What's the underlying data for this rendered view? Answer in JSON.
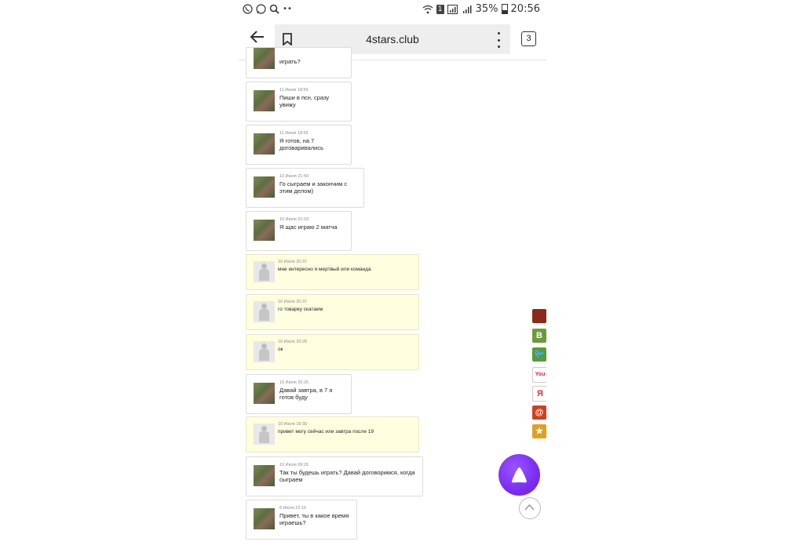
{
  "status_bar": {
    "battery": "35%",
    "time": "20:56",
    "sim": "1",
    "left_icons": [
      "viber-icon",
      "whatsapp-icon",
      "search-icon",
      "more-dots-icon"
    ]
  },
  "browser": {
    "url": "4stars.club",
    "tabs_count": "3"
  },
  "messages": [
    {
      "date": "",
      "text": "играть?",
      "style": "white",
      "avatar": "photo"
    },
    {
      "date": "11 Июля 18:56",
      "text": "Пиши в псн, сразу увижу",
      "style": "white",
      "avatar": "photo"
    },
    {
      "date": "11 Июля 18:55",
      "text": "Я готов, на 7 договаривались",
      "style": "white",
      "avatar": "photo"
    },
    {
      "date": "10 Июля 21:50",
      "text": "Го сыграем и закончим с этим делом)",
      "style": "white",
      "avatar": "photo"
    },
    {
      "date": "10 Июля 21:03",
      "text": "Я щас играю 2 матча",
      "style": "white",
      "avatar": "photo"
    },
    {
      "date": "10 Июля 20:37",
      "text": "мне интересно я мертвый или команда",
      "style": "yellow",
      "avatar": "gray"
    },
    {
      "date": "10 Июля 20:37",
      "text": "го товарку скатаем",
      "style": "yellow",
      "avatar": "gray"
    },
    {
      "date": "10 Июля 20:26",
      "text": "ок",
      "style": "yellow",
      "avatar": "gray"
    },
    {
      "date": "10 Июля 20:26",
      "text": "Давай завтра, в 7 я готов буду",
      "style": "white",
      "avatar": "photo"
    },
    {
      "date": "10 Июля 19:39",
      "text": "привет могу сейчас или завтра после 19",
      "style": "yellow",
      "avatar": "gray"
    },
    {
      "date": "10 Июля 09:26",
      "text": "Так ты будешь играть? Давай договоримся, когда сыграем",
      "style": "white",
      "avatar": "photo"
    },
    {
      "date": "8 Июля 22:15",
      "text": "Привет, ты в какое время играешь?",
      "style": "white",
      "avatar": "photo"
    }
  ],
  "share_icons": [
    {
      "name": "cap-icon",
      "label": "",
      "color": "#8b2a1a"
    },
    {
      "name": "vk-icon",
      "label": "B",
      "color": "#6a9a3a"
    },
    {
      "name": "twitter-icon",
      "label": "🐦",
      "color": "#5a9a3a"
    },
    {
      "name": "youtube-icon",
      "label": "You",
      "color": "#cc2b2b"
    },
    {
      "name": "yandex-icon",
      "label": "Я",
      "color": "#d33"
    },
    {
      "name": "mail-icon",
      "label": "@",
      "color": "#d04020"
    },
    {
      "name": "star-icon",
      "label": "★",
      "color": "#e0a020"
    }
  ]
}
